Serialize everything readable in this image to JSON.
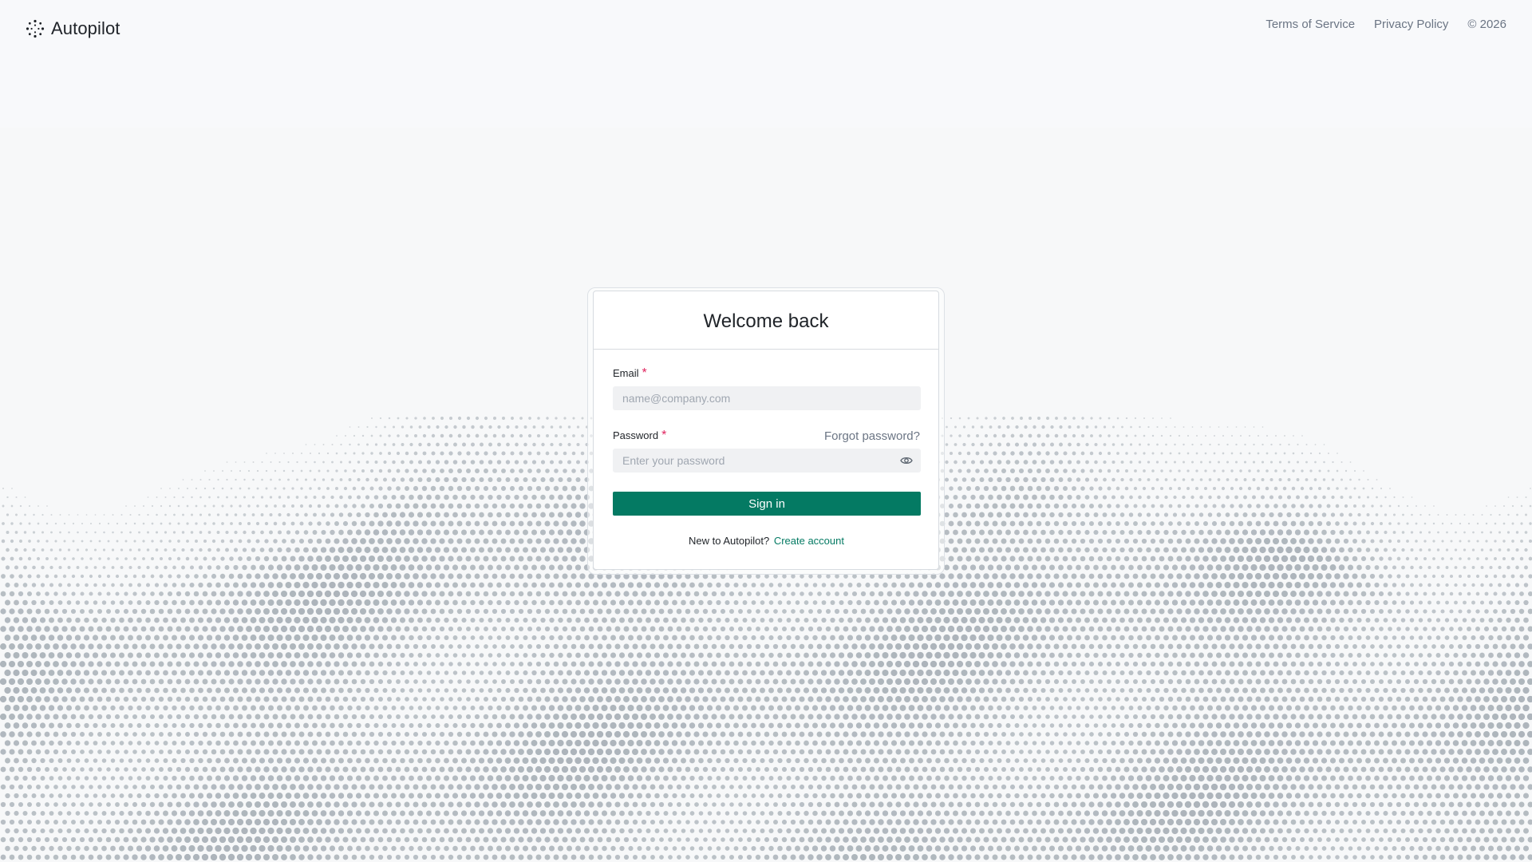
{
  "brand": {
    "name": "Autopilot",
    "icon": "sparkle-dots-icon"
  },
  "header_links": {
    "terms": "Terms of Service",
    "privacy": "Privacy Policy",
    "copyright": "© 2026"
  },
  "login": {
    "title": "Welcome back",
    "email": {
      "label": "Email",
      "required_mark": "*",
      "placeholder": "name@company.com",
      "value": ""
    },
    "password": {
      "label": "Password",
      "required_mark": "*",
      "placeholder": "Enter your password",
      "value": "",
      "toggle_icon": "eye-icon"
    },
    "forgot_label": "Forgot password?",
    "submit_label": "Sign in",
    "signup_prompt": "New to Autopilot?",
    "signup_link": "Create account"
  },
  "colors": {
    "accent": "#047a63",
    "required": "#e0245e",
    "muted_text": "#6b7584",
    "background": "#f7f8f9",
    "dots": "#9aa3ab"
  }
}
